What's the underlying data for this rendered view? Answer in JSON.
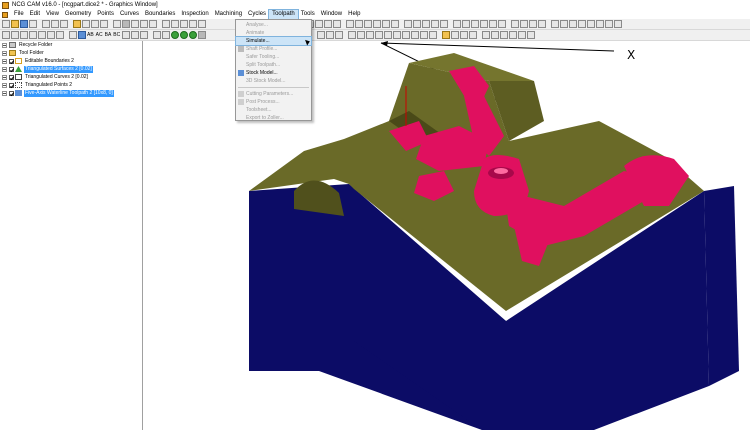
{
  "window": {
    "title": "NCG CAM v16.0 - [ncgpart.dice2 * - Graphics Window]"
  },
  "menubar": {
    "items": [
      "File",
      "Edit",
      "View",
      "Geometry",
      "Points",
      "Curves",
      "Boundaries",
      "Inspection",
      "Machining",
      "Cycles",
      "Toolpath",
      "Tools",
      "Window",
      "Help"
    ],
    "active_index": 10
  },
  "toolbar2_labels": {
    "ab": "AB",
    "ac": "AC",
    "ba": "BA",
    "bc": "BC"
  },
  "tree": {
    "items": [
      {
        "label": "Recycle Folder",
        "checked": false,
        "selected": false,
        "icon": "recycle-bin-icon"
      },
      {
        "label": "Tool Folder",
        "checked": false,
        "selected": false,
        "icon": "folder-icon"
      },
      {
        "label": "Editable Boundaries 2",
        "checked": true,
        "selected": false,
        "icon": "boundary-icon"
      },
      {
        "label": "Triangulated Surfaces 2 [0.02]",
        "checked": true,
        "selected": true,
        "icon": "surface-icon"
      },
      {
        "label": "Triangulated Curves 2 [0.02]",
        "checked": true,
        "selected": false,
        "icon": "curve-icon"
      },
      {
        "label": "Triangulated Points 2",
        "checked": true,
        "selected": false,
        "icon": "points-icon"
      },
      {
        "label": "Five-Axis Waterline Toolpath 2 [10x8, 0]",
        "checked": true,
        "selected": true,
        "icon": "toolpath-icon"
      }
    ]
  },
  "toolpath_menu": {
    "items": [
      {
        "label": "Analyse...",
        "enabled": false
      },
      {
        "label": "Animate",
        "enabled": false
      },
      {
        "label": "Simulate...",
        "enabled": true,
        "hover": true
      },
      {
        "label": "Shaft Profile...",
        "enabled": false
      },
      {
        "label": "Safer Tooling...",
        "enabled": false
      },
      {
        "label": "Split Toolpath...",
        "enabled": false
      },
      {
        "label": "Stock Model...",
        "enabled": true
      },
      {
        "label": "3D Stock Model...",
        "enabled": false
      },
      {
        "label": "Cutting Parameters...",
        "enabled": false
      },
      {
        "label": "Post Process...",
        "enabled": false
      },
      {
        "label": "Toolsheet...",
        "enabled": false
      },
      {
        "label": "Export to Zoller...",
        "enabled": false
      }
    ]
  },
  "viewport": {
    "axis_label": "X",
    "colors": {
      "stock_side": "#0c0c66",
      "stock_top": "#6a6a28",
      "part": "#e0105f"
    }
  }
}
